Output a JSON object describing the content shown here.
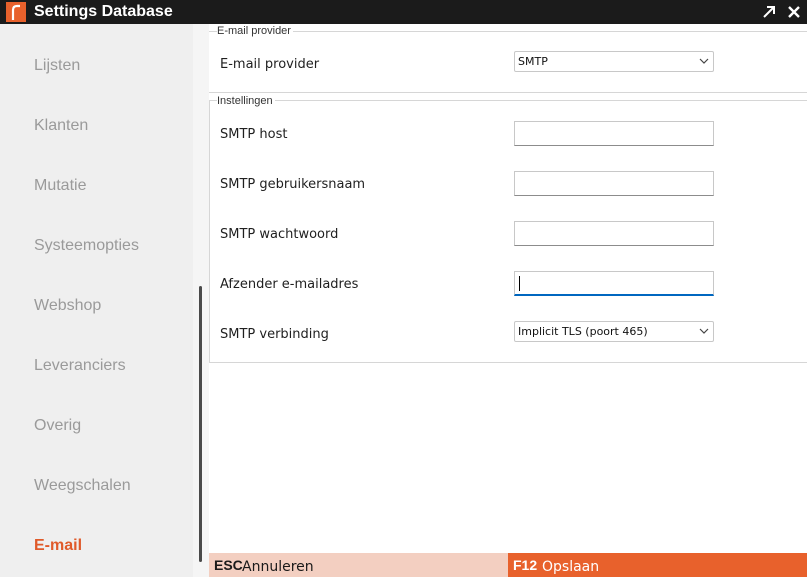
{
  "window": {
    "title": "Settings Database"
  },
  "sidebar": {
    "items": [
      {
        "label": "Lijsten"
      },
      {
        "label": "Klanten"
      },
      {
        "label": "Mutatie"
      },
      {
        "label": "Systeemopties"
      },
      {
        "label": "Webshop"
      },
      {
        "label": "Leveranciers"
      },
      {
        "label": "Overig"
      },
      {
        "label": "Weegschalen"
      },
      {
        "label": "E-mail",
        "active": true
      }
    ]
  },
  "provider_group": {
    "title": "E-mail provider",
    "provider_label": "E-mail provider",
    "provider_value": "SMTP"
  },
  "settings_group": {
    "title": "Instellingen",
    "host_label": "SMTP host",
    "host_value": "",
    "user_label": "SMTP gebruikersnaam",
    "user_value": "",
    "password_label": "SMTP wachtwoord",
    "password_value": "",
    "sender_label": "Afzender e-mailadres",
    "sender_value": "",
    "connection_label": "SMTP verbinding",
    "connection_value": "Implicit TLS (poort 465)"
  },
  "footer": {
    "cancel_key": "ESC",
    "cancel_label": "Annuleren",
    "save_key": "F12",
    "save_label": "Opslaan"
  },
  "colors": {
    "accent": "#e8612c",
    "titlebar": "#1b1b1b",
    "sidebar_bg": "#efefef",
    "cancel_bg": "#f3cfc1",
    "focus": "#0067c0"
  }
}
